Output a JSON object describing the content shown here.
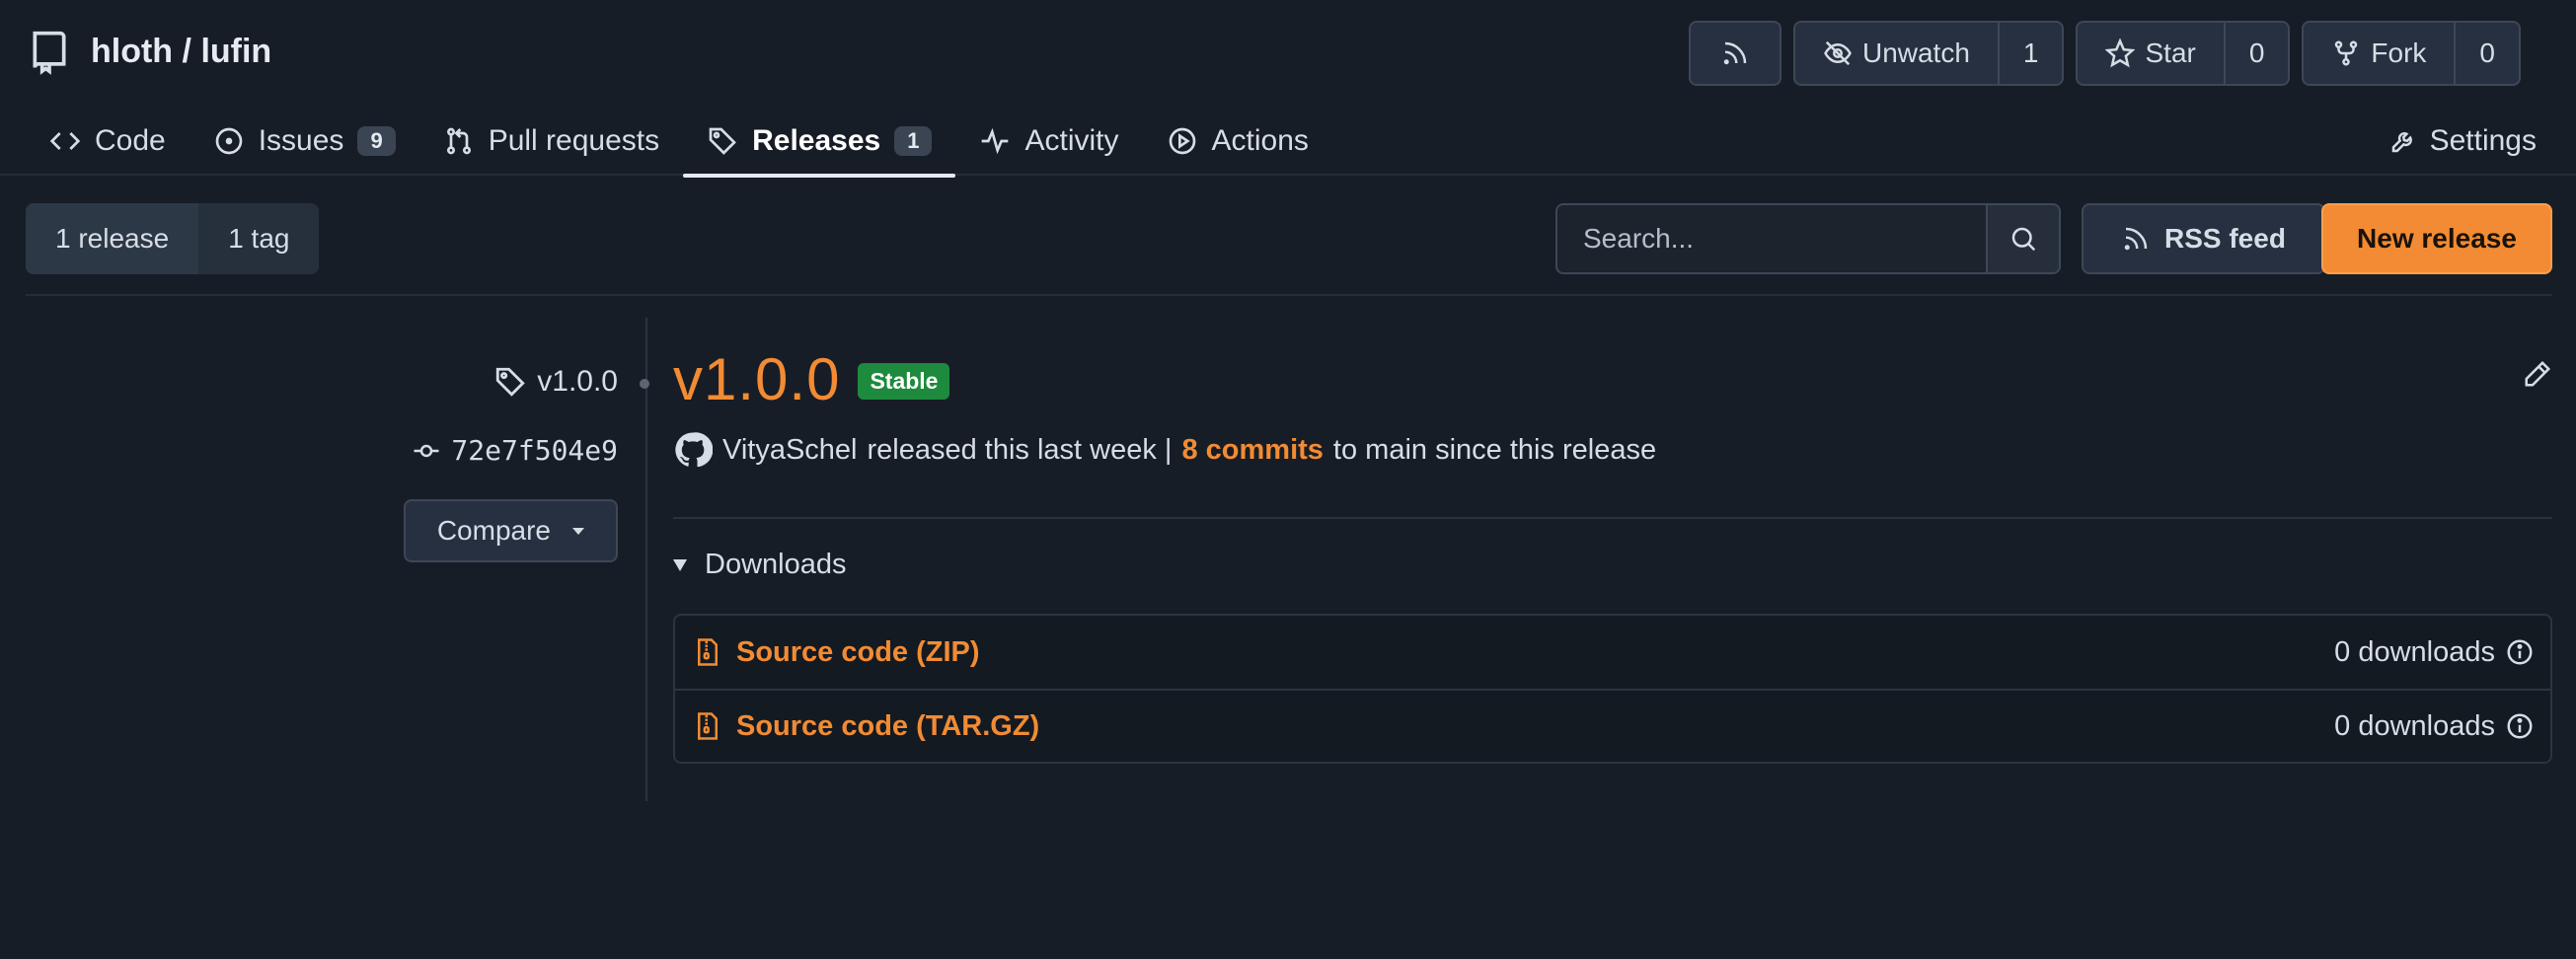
{
  "repo": {
    "owner": "hloth",
    "separator": "/",
    "name": "lufin"
  },
  "header_actions": {
    "unwatch_label": "Unwatch",
    "watch_count": "1",
    "star_label": "Star",
    "star_count": "0",
    "fork_label": "Fork",
    "fork_count": "0"
  },
  "tabs": [
    {
      "label": "Code",
      "icon": "code-icon"
    },
    {
      "label": "Issues",
      "count": "9",
      "icon": "issue-icon"
    },
    {
      "label": "Pull requests",
      "icon": "pull-request-icon"
    },
    {
      "label": "Releases",
      "count": "1",
      "icon": "tag-icon",
      "active": true
    },
    {
      "label": "Activity",
      "icon": "pulse-icon"
    },
    {
      "label": "Actions",
      "icon": "play-icon"
    }
  ],
  "settings_label": "Settings",
  "subnav": {
    "releases_label": "1 release",
    "tags_label": "1 tag"
  },
  "search": {
    "placeholder": "Search..."
  },
  "rss_label": "RSS feed",
  "new_release_label": "New release",
  "release": {
    "tag": "v1.0.0",
    "commit": "72e7f504e9",
    "compare_label": "Compare",
    "title": "v1.0.0",
    "badge": "Stable",
    "author": "VityaSchel",
    "released_text": "released this last week |",
    "commits_link": "8 commits",
    "since_text": "to main since this release",
    "downloads_label": "Downloads",
    "assets": [
      {
        "name": "Source code (ZIP)",
        "downloads": "0 downloads"
      },
      {
        "name": "Source code (TAR.GZ)",
        "downloads": "0 downloads"
      }
    ]
  },
  "colors": {
    "accent": "#f28b33",
    "stable_badge": "#1e8a3d",
    "background": "#171d26"
  }
}
